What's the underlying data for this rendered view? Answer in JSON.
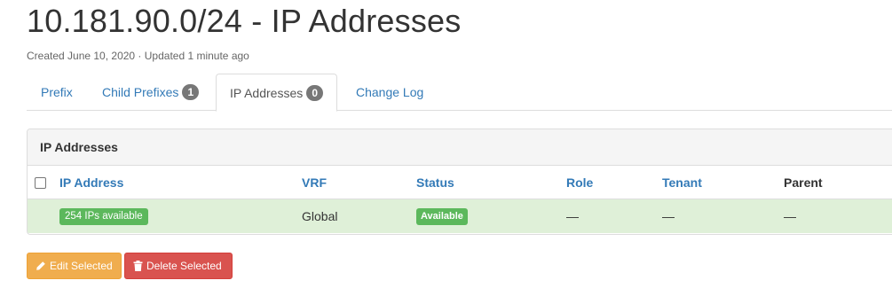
{
  "page": {
    "title": "10.181.90.0/24 - IP Addresses",
    "meta": "Created June 10, 2020 · Updated 1 minute ago"
  },
  "tabs": [
    {
      "label": "Prefix"
    },
    {
      "label": "Child Prefixes",
      "badge": "1"
    },
    {
      "label": "IP Addresses",
      "badge": "0",
      "active": true
    },
    {
      "label": "Change Log"
    }
  ],
  "panel": {
    "heading": "IP Addresses",
    "columns": [
      "IP Address",
      "VRF",
      "Status",
      "Role",
      "Tenant",
      "Parent"
    ],
    "rows": [
      {
        "ip_address": "254 IPs available",
        "vrf": "Global",
        "status": "Available",
        "role": "—",
        "tenant": "—",
        "parent": "—"
      }
    ]
  },
  "buttons": {
    "edit_selected": "Edit Selected",
    "delete_selected": "Delete Selected"
  },
  "icons": {
    "edit": "pencil-icon",
    "delete": "trash-icon"
  },
  "colors": {
    "link": "#337ab7",
    "success": "#5cb85c",
    "row_success": "#dff0d8",
    "warning": "#f0ad4e",
    "danger": "#d9534f",
    "badge": "#777777"
  }
}
